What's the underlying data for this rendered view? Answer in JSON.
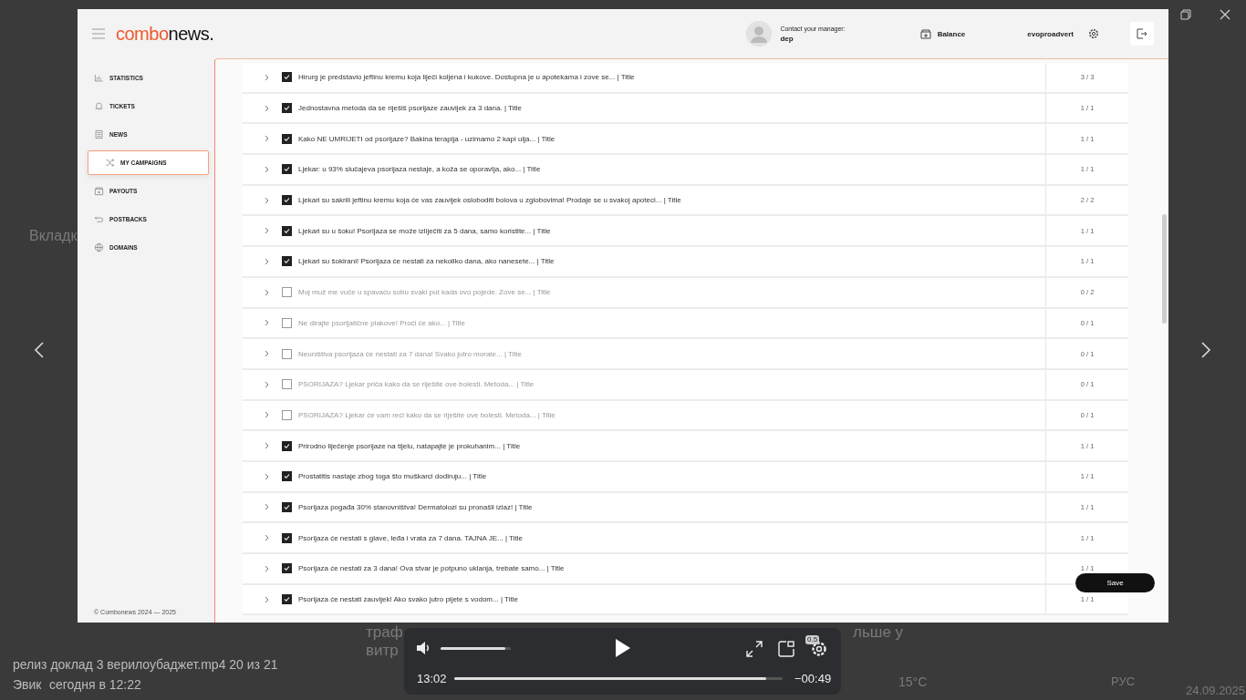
{
  "backdrop": [
    {
      "text": "Вкладк"
    },
    {
      "text": "траф"
    },
    {
      "text": "витр"
    },
    {
      "text": "льше у"
    },
    {
      "text": "15°C"
    },
    {
      "text": "РУС"
    },
    {
      "text": "24.09.2025"
    }
  ],
  "app": {
    "logo": {
      "accent": "combo",
      "rest": "news."
    },
    "header": {
      "contact_label": "Contact your manager:",
      "manager": "dep",
      "balance": "Balance",
      "username": "evoproadvert"
    },
    "sidebar": {
      "items": [
        {
          "label": "STATISTICS",
          "selected": false
        },
        {
          "label": "TICKETS",
          "selected": false
        },
        {
          "label": "NEWS",
          "selected": false
        },
        {
          "label": "MY CAMPAIGNS",
          "selected": true
        },
        {
          "label": "PAYOUTS",
          "selected": false
        },
        {
          "label": "POSTBACKS",
          "selected": false
        },
        {
          "label": "DOMAINS",
          "selected": false
        }
      ],
      "footer": "© Combonews  2024 — 2025"
    },
    "rows": [
      {
        "title": "Hirurg je predstavio jeftinu kremu koja liječi koljena i kukove. Dostupna je u apotekama i zove se... | Title",
        "checked": true,
        "count": "3 / 3"
      },
      {
        "title": "Jednostavna metoda da se riješiš psorijaze zauvijek za 3 dana. | Title",
        "checked": true,
        "count": "1 / 1"
      },
      {
        "title": "Kako NE UMRIJETI od psorijaze? Bakina terapija - uzimamo 2 kapi ulja... | Title",
        "checked": true,
        "count": "1 / 1"
      },
      {
        "title": "Ljekar: u 93% slučajeva psorijaza nestaje, a koža se oporavlja, ako... | Title",
        "checked": true,
        "count": "1 / 1"
      },
      {
        "title": "Ljekari su sakrili jeftinu kremu koja će vas zauvijek osloboditi bolova u zglobovima! Prodaje se u svakoj apoteci... | Title",
        "checked": true,
        "count": "2 / 2"
      },
      {
        "title": "Ljekari su u šoku! Psorijaza se može izliječiti za 5 dana, samo koristite... | Title",
        "checked": true,
        "count": "1 / 1"
      },
      {
        "title": "Ljekari su šokirani! Psorijaza će nestati za nekoliko dana, ako nanesete... | Title",
        "checked": true,
        "count": "1 / 1"
      },
      {
        "title": "Moj muž me vuče u spavaću sobu svaki put kada ovo pojede. Zove se... | Title",
        "checked": false,
        "count": "0 / 2"
      },
      {
        "title": "Ne dirajte psorijatične plakove! Proći će ako... | Title",
        "checked": false,
        "count": "0 / 1"
      },
      {
        "title": "Neuništiva psorijaza će nestati za 7 dana! Svako jutro morate... | Title",
        "checked": false,
        "count": "0 / 1"
      },
      {
        "title": "PSORIJAZA? Ljekar priča kako da se riješite ove bolesti. Metoda... | Title",
        "checked": false,
        "count": "0 / 1"
      },
      {
        "title": "PSORIJAZA? Ljekar će vam reći kako da se riješite ove bolesti. Metoda... | Title",
        "checked": false,
        "count": "0 / 1"
      },
      {
        "title": "Prirodno liječenje psorijaze na tijelu, natapajte je prokuhanim... | Title",
        "checked": true,
        "count": "1 / 1"
      },
      {
        "title": "Prostatitis nastaje zbog toga što muškarci dodiruju... | Title",
        "checked": true,
        "count": "1 / 1"
      },
      {
        "title": "Psorijaza pogađa 30% stanovništva! Dermatolozi su pronašli izlaz! | Title",
        "checked": true,
        "count": "1 / 1"
      },
      {
        "title": "Psorijaza će nestati s glave, leđa i vrata za 7 dana. TAJNA JE... | Title",
        "checked": true,
        "count": "1 / 1"
      },
      {
        "title": "Psorijaza će nestati za 3 dana! Ova stvar je potpuno uklanja, trebate samo... | Title",
        "checked": true,
        "count": "1 / 1"
      },
      {
        "title": "Psorijaza će nestati zauvijek! Ako svako jutro pijete s vodom... | Title",
        "checked": true,
        "count": "1 / 1"
      }
    ],
    "save_button": "Save"
  },
  "caption": {
    "file": "релиз доклад 3 верилоубаджет.mp4 20 из 21",
    "author": "Эвик",
    "date": "сегодня в 12:22"
  },
  "player": {
    "volume": {
      "level": 0.92
    },
    "progress": {
      "level": 0.95
    },
    "elapsed": "13:02",
    "remaining": "−00:49",
    "speed": "0.5"
  }
}
